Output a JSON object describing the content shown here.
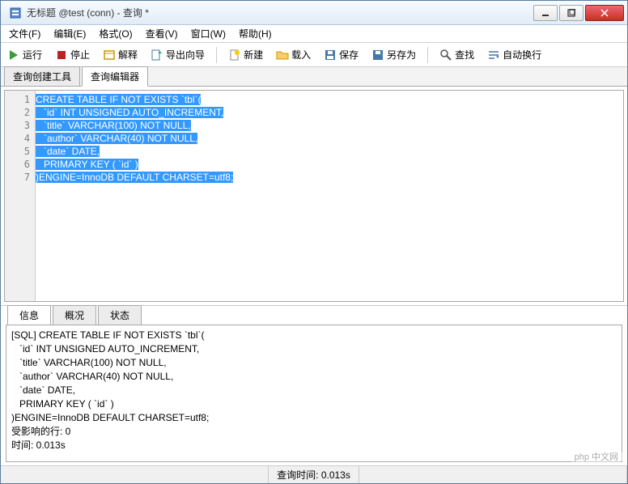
{
  "window": {
    "title": "无标题 @test (conn) - 查询 *"
  },
  "menu": {
    "file": "文件(F)",
    "edit": "编辑(E)",
    "format": "格式(O)",
    "view": "查看(V)",
    "window": "窗口(W)",
    "help": "帮助(H)"
  },
  "toolbar": {
    "run": "运行",
    "stop": "停止",
    "explain": "解释",
    "export": "导出向导",
    "new": "新建",
    "load": "载入",
    "save": "保存",
    "saveas": "另存为",
    "find": "查找",
    "wrap": "自动换行"
  },
  "editor_tabs": {
    "builder": "查询创建工具",
    "editor": "查询编辑器"
  },
  "code": {
    "lines": [
      "CREATE TABLE IF NOT EXISTS `tbl`(",
      "   `id` INT UNSIGNED AUTO_INCREMENT,",
      "   `title` VARCHAR(100) NOT NULL,",
      "   `author` VARCHAR(40) NOT NULL,",
      "   `date` DATE,",
      "   PRIMARY KEY ( `id` )",
      ")ENGINE=InnoDB DEFAULT CHARSET=utf8;"
    ],
    "line_numbers": [
      "1",
      "2",
      "3",
      "4",
      "5",
      "6",
      "7"
    ]
  },
  "result_tabs": {
    "info": "信息",
    "profile": "概况",
    "status": "状态"
  },
  "result_text": "[SQL] CREATE TABLE IF NOT EXISTS `tbl`(\n   `id` INT UNSIGNED AUTO_INCREMENT,\n   `title` VARCHAR(100) NOT NULL,\n   `author` VARCHAR(40) NOT NULL,\n   `date` DATE,\n   PRIMARY KEY ( `id` )\n)ENGINE=InnoDB DEFAULT CHARSET=utf8;\n受影响的行: 0\n时间: 0.013s",
  "statusbar": {
    "query_time": "查询时间: 0.013s"
  },
  "watermark": "php 中文网"
}
